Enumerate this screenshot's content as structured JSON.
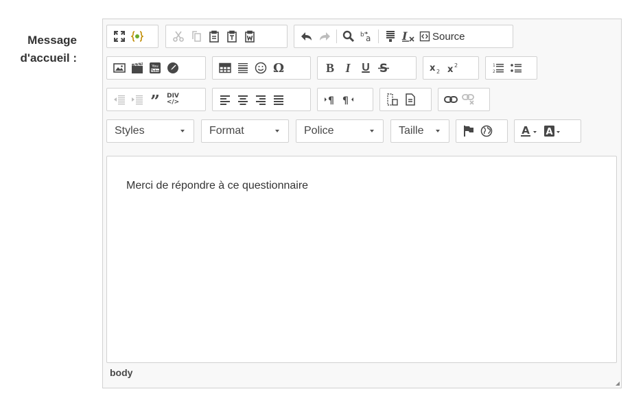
{
  "field": {
    "label_line1": "Message",
    "label_line2": "d'accueil :"
  },
  "toolbar": {
    "source_label": "Source",
    "underline_letter": "U",
    "bold_letter": "B",
    "italic_letter": "I",
    "div_label_top": "DIV",
    "div_label_bottom": "</>",
    "youtube_label": "You Tube",
    "combos": {
      "styles": "Styles",
      "format": "Format",
      "police": "Police",
      "taille": "Taille"
    },
    "icons": [
      "maximize-icon",
      "show-blocks-icon",
      "cut-icon",
      "copy-icon",
      "paste-icon",
      "paste-text-icon",
      "paste-word-icon",
      "undo-icon",
      "redo-icon",
      "find-icon",
      "replace-icon",
      "select-all-icon",
      "remove-format-icon",
      "source-icon",
      "image-icon",
      "flash-icon",
      "youtube-icon",
      "iframe-icon",
      "table-icon",
      "horizontal-rule-icon",
      "smiley-icon",
      "special-char-icon",
      "bold-icon",
      "italic-icon",
      "underline-icon",
      "strike-icon",
      "subscript-icon",
      "superscript-icon",
      "numbered-list-icon",
      "bulleted-list-icon",
      "outdent-icon",
      "indent-icon",
      "blockquote-icon",
      "div-container-icon",
      "align-left-icon",
      "align-center-icon",
      "align-right-icon",
      "justify-icon",
      "ltr-icon",
      "rtl-icon",
      "templates-icon",
      "new-page-icon",
      "link-icon",
      "unlink-icon",
      "anchor-flag-icon",
      "language-globe-icon",
      "text-color-icon",
      "background-color-icon"
    ],
    "colors": {
      "accent": "#474747",
      "disabled": "#bdbdbd",
      "border": "#d1d1d1",
      "chrome": "#f8f8f8"
    }
  },
  "content": {
    "text": "Merci de répondre à ce questionnaire"
  },
  "statusbar": {
    "path": "body"
  }
}
